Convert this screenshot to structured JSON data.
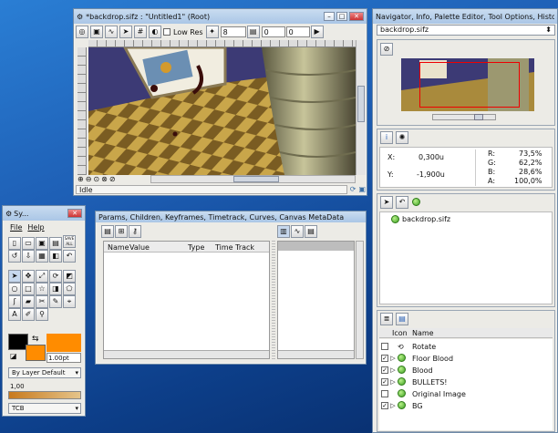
{
  "canvas_window": {
    "title": "*backdrop.sifz : \"Untitled1\" (Root)",
    "toolbar": {
      "low_res_label": "Low Res",
      "zoom_value": "8",
      "field2": "0",
      "field3": "0"
    },
    "status": "Idle"
  },
  "dock_right": {
    "title": "Navigator, Info, Palette Editor, Tool Options, History, Canv...",
    "file_selector": "backdrop.sifz",
    "info": {
      "x_label": "X:",
      "x_value": "0,300u",
      "y_label": "Y:",
      "y_value": "-1,900u",
      "r_label": "R:",
      "r_value": "73,5%",
      "g_label": "G:",
      "g_value": "62,2%",
      "b_label": "B:",
      "b_value": "28,6%",
      "a_label": "A:",
      "a_value": "100,0%"
    },
    "canvas_browser_item": "backdrop.sifz",
    "layers": {
      "col_icon": "Icon",
      "col_name": "Name",
      "rows": [
        {
          "name": "Rotate",
          "checked": false,
          "expand": false
        },
        {
          "name": "Floor Blood",
          "checked": true,
          "expand": true
        },
        {
          "name": "Blood",
          "checked": true,
          "expand": true
        },
        {
          "name": "BULLETS!",
          "checked": true,
          "expand": true
        },
        {
          "name": "Original Image",
          "checked": false,
          "expand": false
        },
        {
          "name": "BG",
          "checked": true,
          "expand": true
        }
      ]
    }
  },
  "toolbox": {
    "title": "Sy...",
    "menu": {
      "file": "File",
      "help": "Help"
    },
    "save_all": "SAVE ALL",
    "brush_size": "1.00pt",
    "blend_method": "By Layer Default",
    "amount": "1,00",
    "interpolation": "TCB"
  },
  "params_window": {
    "title": "Params, Children, Keyframes, Timetrack, Curves, Canvas MetaData",
    "columns": {
      "name": "Name",
      "value": "Value",
      "type": "Type",
      "time_track": "Time Track"
    }
  },
  "colors": {
    "fill": "#ff8c00",
    "outline": "#000000",
    "accent": "#3a6ea5"
  }
}
